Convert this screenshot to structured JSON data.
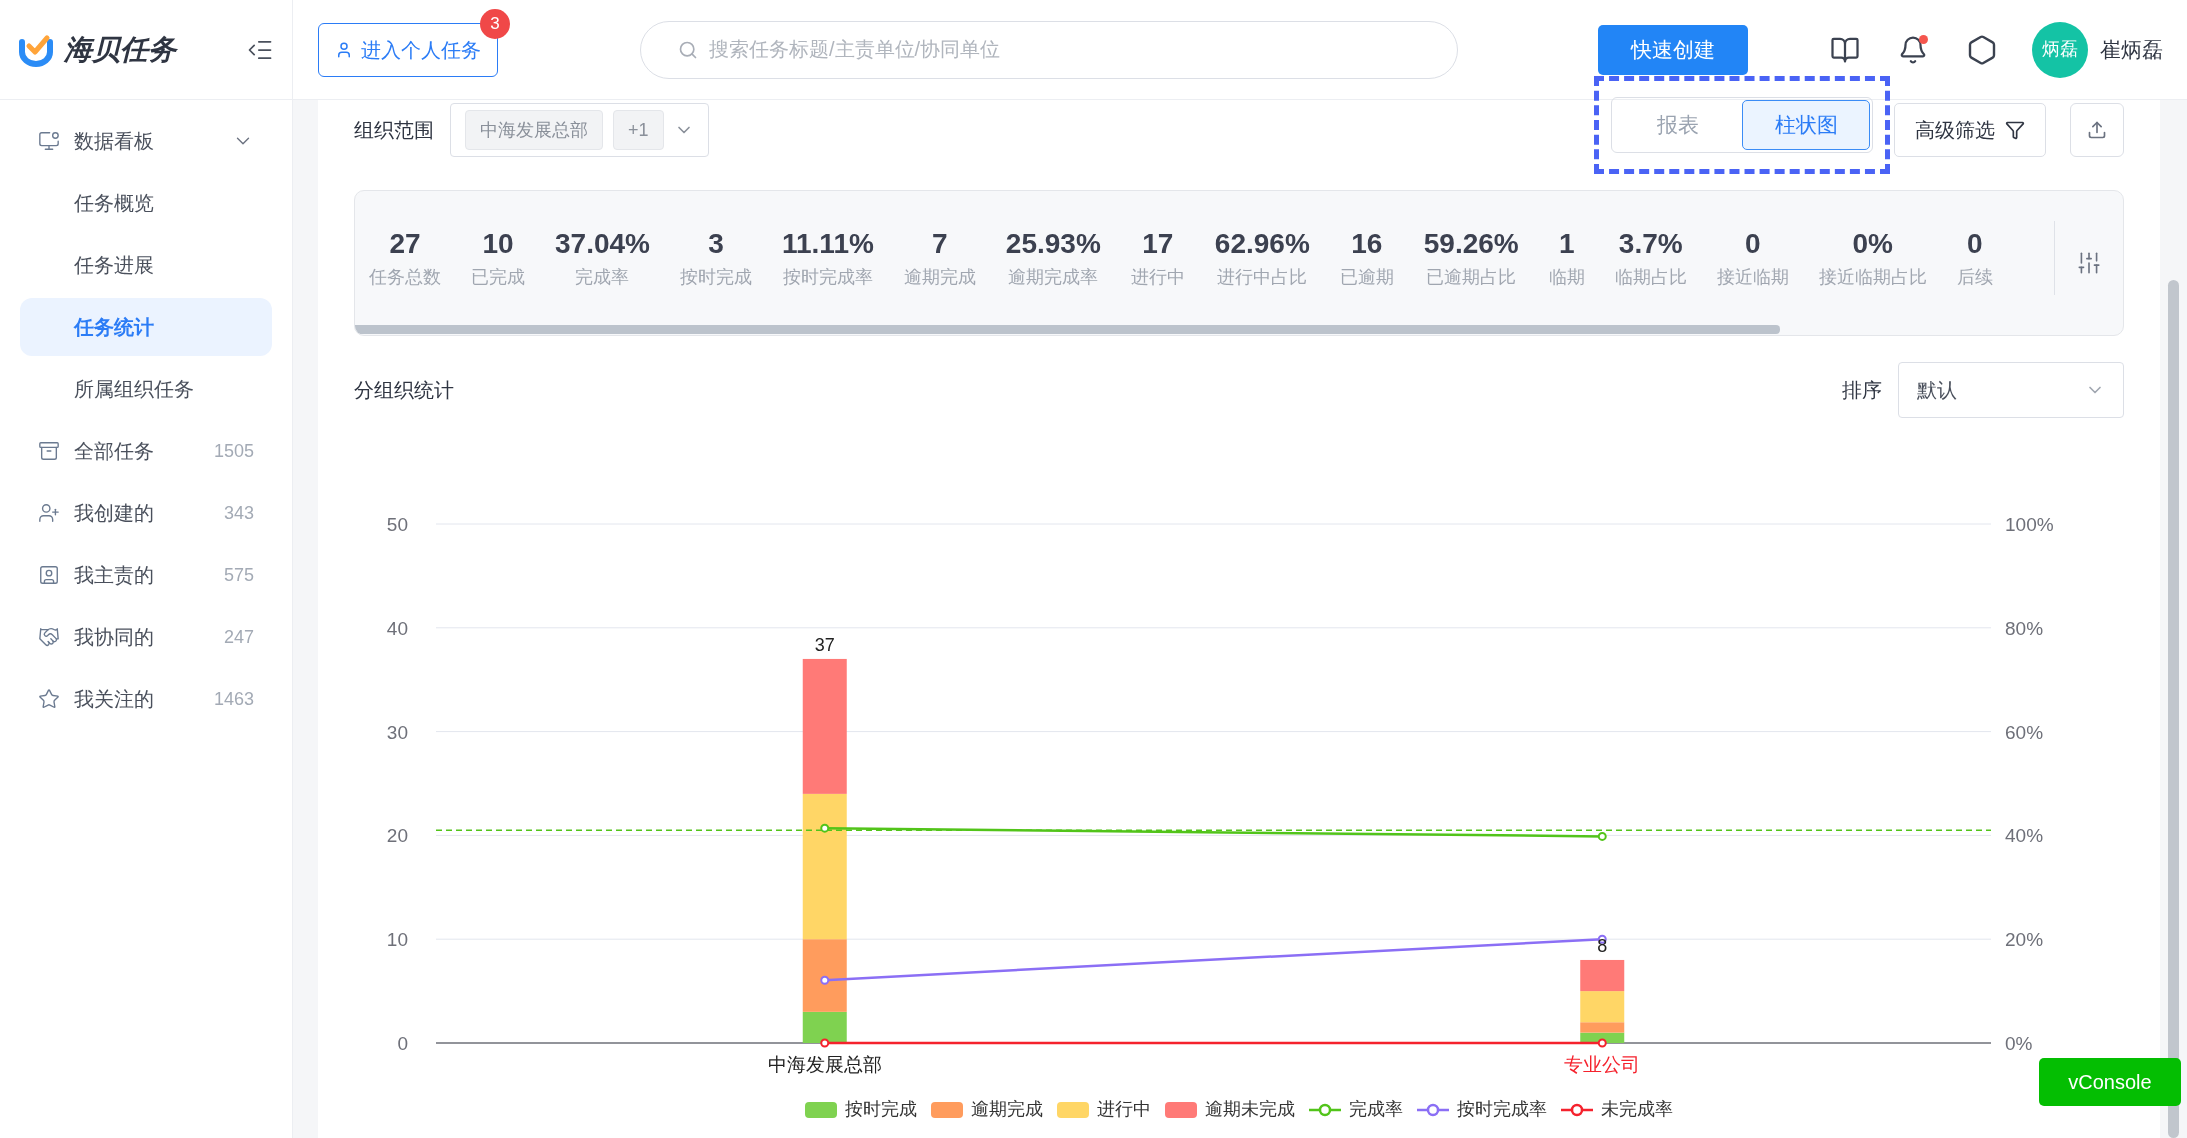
{
  "app": {
    "name": "海贝任务"
  },
  "header": {
    "personal_button": {
      "label": "进入个人任务",
      "badge": "3"
    },
    "search": {
      "placeholder": "搜索任务标题/主责单位/协同单位"
    },
    "create_button": "快速创建",
    "notifications": {
      "unread": true
    },
    "user": {
      "avatar": "炳磊",
      "name": "崔炳磊"
    }
  },
  "sidebar": {
    "items": [
      {
        "label": "数据看板",
        "expanded": true,
        "children": [
          {
            "label": "任务概览",
            "selected": false
          },
          {
            "label": "任务进展",
            "selected": false
          },
          {
            "label": "任务统计",
            "selected": true
          },
          {
            "label": "所属组织任务",
            "selected": false
          }
        ]
      },
      {
        "label": "全部任务",
        "count": "1505"
      },
      {
        "label": "我创建的",
        "count": "343"
      },
      {
        "label": "我主责的",
        "count": "575"
      },
      {
        "label": "我协同的",
        "count": "247"
      },
      {
        "label": "我关注的",
        "count": "1463"
      }
    ]
  },
  "toolbar": {
    "scope_label": "组织范围",
    "scope_tags": [
      "中海发展总部",
      "+1"
    ],
    "view_tabs": [
      {
        "label": "报表",
        "selected": false
      },
      {
        "label": "柱状图",
        "selected": true
      }
    ],
    "filter_button": "高级筛选"
  },
  "stats": [
    {
      "value": "27",
      "label": "任务总数"
    },
    {
      "value": "10",
      "label": "已完成"
    },
    {
      "value": "37.04%",
      "label": "完成率"
    },
    {
      "value": "3",
      "label": "按时完成"
    },
    {
      "value": "11.11%",
      "label": "按时完成率"
    },
    {
      "value": "7",
      "label": "逾期完成"
    },
    {
      "value": "25.93%",
      "label": "逾期完成率"
    },
    {
      "value": "17",
      "label": "进行中"
    },
    {
      "value": "62.96%",
      "label": "进行中占比"
    },
    {
      "value": "16",
      "label": "已逾期"
    },
    {
      "value": "59.26%",
      "label": "已逾期占比"
    },
    {
      "value": "1",
      "label": "临期"
    },
    {
      "value": "3.7%",
      "label": "临期占比"
    },
    {
      "value": "0",
      "label": "接近临期"
    },
    {
      "value": "0%",
      "label": "接近临期占比"
    },
    {
      "value": "0",
      "label": "后续"
    }
  ],
  "section": {
    "title": "分组织统计",
    "sort_label": "排序",
    "sort_value": "默认",
    "category_highlighted": [
      false,
      true
    ],
    "chart_data": {
      "type": "bar",
      "stacked": true,
      "grid": true,
      "categories": [
        "中海发展总部",
        "专业公司"
      ],
      "series": [
        {
          "name": "按时完成",
          "color": "#7fd250",
          "type": "bar",
          "values": [
            3,
            1
          ]
        },
        {
          "name": "逾期完成",
          "color": "#ff9c5d",
          "type": "bar",
          "values": [
            7,
            1
          ]
        },
        {
          "name": "进行中",
          "color": "#ffd666",
          "type": "bar",
          "values": [
            14,
            3
          ]
        },
        {
          "name": "逾期未完成",
          "color": "#ff7a77",
          "type": "bar",
          "values": [
            13,
            3
          ]
        },
        {
          "name": "完成率",
          "color": "#52c41a",
          "type": "line",
          "axis": "y2",
          "marker": "o",
          "values": [
            41.4,
            39.8
          ]
        },
        {
          "name": "按时完成率",
          "color": "#8b6ff5",
          "type": "line",
          "axis": "y2",
          "marker": "o",
          "values": [
            12.1,
            20
          ]
        },
        {
          "name": "未完成率",
          "color": "#f5222d",
          "type": "line",
          "axis": "y2",
          "marker": "o",
          "values": [
            0,
            0
          ]
        }
      ],
      "value_labels": [
        "37",
        "8"
      ],
      "ylim": [
        0,
        50
      ],
      "yticks": [
        0,
        10,
        20,
        30,
        40,
        50
      ],
      "y2lim": [
        0,
        100
      ],
      "y2ticks": [
        {
          "value": 0,
          "label": "0%"
        },
        {
          "value": 20,
          "label": "20%"
        },
        {
          "value": 40,
          "label": "40%"
        },
        {
          "value": 60,
          "label": "60%"
        },
        {
          "value": 80,
          "label": "80%"
        },
        {
          "value": 100,
          "label": "100%"
        }
      ],
      "ref_lines": [
        {
          "axis": "y",
          "value": 20.5,
          "color": "#52c41a"
        }
      ]
    }
  },
  "console_button": "vConsole"
}
